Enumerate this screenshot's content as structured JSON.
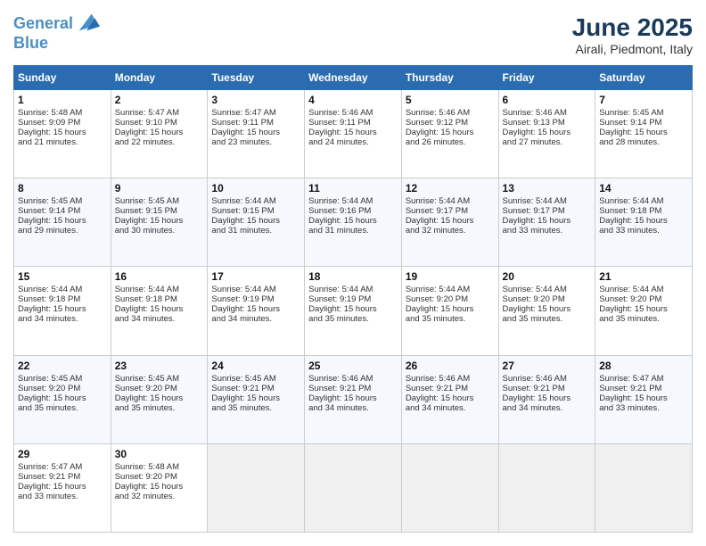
{
  "logo": {
    "line1": "General",
    "line2": "Blue"
  },
  "title": "June 2025",
  "location": "Airali, Piedmont, Italy",
  "header_days": [
    "Sunday",
    "Monday",
    "Tuesday",
    "Wednesday",
    "Thursday",
    "Friday",
    "Saturday"
  ],
  "weeks": [
    [
      {
        "day": "1",
        "lines": [
          "Sunrise: 5:48 AM",
          "Sunset: 9:09 PM",
          "Daylight: 15 hours",
          "and 21 minutes."
        ]
      },
      {
        "day": "2",
        "lines": [
          "Sunrise: 5:47 AM",
          "Sunset: 9:10 PM",
          "Daylight: 15 hours",
          "and 22 minutes."
        ]
      },
      {
        "day": "3",
        "lines": [
          "Sunrise: 5:47 AM",
          "Sunset: 9:11 PM",
          "Daylight: 15 hours",
          "and 23 minutes."
        ]
      },
      {
        "day": "4",
        "lines": [
          "Sunrise: 5:46 AM",
          "Sunset: 9:11 PM",
          "Daylight: 15 hours",
          "and 24 minutes."
        ]
      },
      {
        "day": "5",
        "lines": [
          "Sunrise: 5:46 AM",
          "Sunset: 9:12 PM",
          "Daylight: 15 hours",
          "and 26 minutes."
        ]
      },
      {
        "day": "6",
        "lines": [
          "Sunrise: 5:46 AM",
          "Sunset: 9:13 PM",
          "Daylight: 15 hours",
          "and 27 minutes."
        ]
      },
      {
        "day": "7",
        "lines": [
          "Sunrise: 5:45 AM",
          "Sunset: 9:14 PM",
          "Daylight: 15 hours",
          "and 28 minutes."
        ]
      }
    ],
    [
      {
        "day": "8",
        "lines": [
          "Sunrise: 5:45 AM",
          "Sunset: 9:14 PM",
          "Daylight: 15 hours",
          "and 29 minutes."
        ]
      },
      {
        "day": "9",
        "lines": [
          "Sunrise: 5:45 AM",
          "Sunset: 9:15 PM",
          "Daylight: 15 hours",
          "and 30 minutes."
        ]
      },
      {
        "day": "10",
        "lines": [
          "Sunrise: 5:44 AM",
          "Sunset: 9:15 PM",
          "Daylight: 15 hours",
          "and 31 minutes."
        ]
      },
      {
        "day": "11",
        "lines": [
          "Sunrise: 5:44 AM",
          "Sunset: 9:16 PM",
          "Daylight: 15 hours",
          "and 31 minutes."
        ]
      },
      {
        "day": "12",
        "lines": [
          "Sunrise: 5:44 AM",
          "Sunset: 9:17 PM",
          "Daylight: 15 hours",
          "and 32 minutes."
        ]
      },
      {
        "day": "13",
        "lines": [
          "Sunrise: 5:44 AM",
          "Sunset: 9:17 PM",
          "Daylight: 15 hours",
          "and 33 minutes."
        ]
      },
      {
        "day": "14",
        "lines": [
          "Sunrise: 5:44 AM",
          "Sunset: 9:18 PM",
          "Daylight: 15 hours",
          "and 33 minutes."
        ]
      }
    ],
    [
      {
        "day": "15",
        "lines": [
          "Sunrise: 5:44 AM",
          "Sunset: 9:18 PM",
          "Daylight: 15 hours",
          "and 34 minutes."
        ]
      },
      {
        "day": "16",
        "lines": [
          "Sunrise: 5:44 AM",
          "Sunset: 9:18 PM",
          "Daylight: 15 hours",
          "and 34 minutes."
        ]
      },
      {
        "day": "17",
        "lines": [
          "Sunrise: 5:44 AM",
          "Sunset: 9:19 PM",
          "Daylight: 15 hours",
          "and 34 minutes."
        ]
      },
      {
        "day": "18",
        "lines": [
          "Sunrise: 5:44 AM",
          "Sunset: 9:19 PM",
          "Daylight: 15 hours",
          "and 35 minutes."
        ]
      },
      {
        "day": "19",
        "lines": [
          "Sunrise: 5:44 AM",
          "Sunset: 9:20 PM",
          "Daylight: 15 hours",
          "and 35 minutes."
        ]
      },
      {
        "day": "20",
        "lines": [
          "Sunrise: 5:44 AM",
          "Sunset: 9:20 PM",
          "Daylight: 15 hours",
          "and 35 minutes."
        ]
      },
      {
        "day": "21",
        "lines": [
          "Sunrise: 5:44 AM",
          "Sunset: 9:20 PM",
          "Daylight: 15 hours",
          "and 35 minutes."
        ]
      }
    ],
    [
      {
        "day": "22",
        "lines": [
          "Sunrise: 5:45 AM",
          "Sunset: 9:20 PM",
          "Daylight: 15 hours",
          "and 35 minutes."
        ]
      },
      {
        "day": "23",
        "lines": [
          "Sunrise: 5:45 AM",
          "Sunset: 9:20 PM",
          "Daylight: 15 hours",
          "and 35 minutes."
        ]
      },
      {
        "day": "24",
        "lines": [
          "Sunrise: 5:45 AM",
          "Sunset: 9:21 PM",
          "Daylight: 15 hours",
          "and 35 minutes."
        ]
      },
      {
        "day": "25",
        "lines": [
          "Sunrise: 5:46 AM",
          "Sunset: 9:21 PM",
          "Daylight: 15 hours",
          "and 34 minutes."
        ]
      },
      {
        "day": "26",
        "lines": [
          "Sunrise: 5:46 AM",
          "Sunset: 9:21 PM",
          "Daylight: 15 hours",
          "and 34 minutes."
        ]
      },
      {
        "day": "27",
        "lines": [
          "Sunrise: 5:46 AM",
          "Sunset: 9:21 PM",
          "Daylight: 15 hours",
          "and 34 minutes."
        ]
      },
      {
        "day": "28",
        "lines": [
          "Sunrise: 5:47 AM",
          "Sunset: 9:21 PM",
          "Daylight: 15 hours",
          "and 33 minutes."
        ]
      }
    ],
    [
      {
        "day": "29",
        "lines": [
          "Sunrise: 5:47 AM",
          "Sunset: 9:21 PM",
          "Daylight: 15 hours",
          "and 33 minutes."
        ]
      },
      {
        "day": "30",
        "lines": [
          "Sunrise: 5:48 AM",
          "Sunset: 9:20 PM",
          "Daylight: 15 hours",
          "and 32 minutes."
        ]
      },
      {
        "day": "",
        "lines": []
      },
      {
        "day": "",
        "lines": []
      },
      {
        "day": "",
        "lines": []
      },
      {
        "day": "",
        "lines": []
      },
      {
        "day": "",
        "lines": []
      }
    ]
  ]
}
